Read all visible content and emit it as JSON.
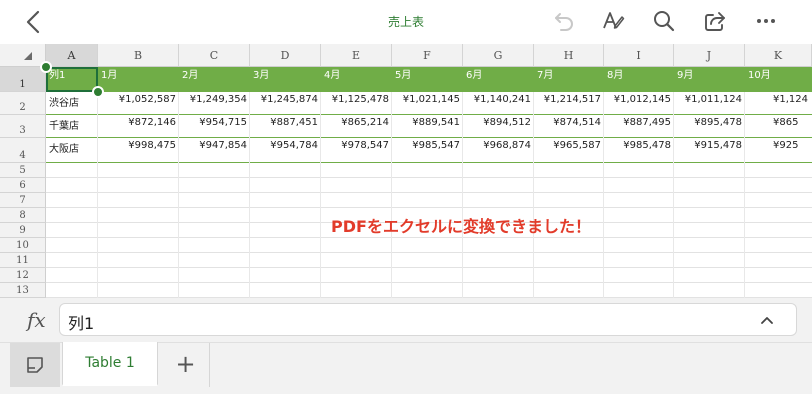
{
  "toolbar": {
    "title": "売上表"
  },
  "columns": [
    "A",
    "B",
    "C",
    "D",
    "E",
    "F",
    "G",
    "H",
    "I",
    "J",
    "K"
  ],
  "rows": [
    "1",
    "2",
    "3",
    "4",
    "5",
    "6",
    "7",
    "8",
    "9",
    "10",
    "11",
    "12",
    "13"
  ],
  "table": {
    "header": [
      "列1",
      "1月",
      "2月",
      "3月",
      "4月",
      "5月",
      "6月",
      "7月",
      "8月",
      "9月",
      "10月"
    ],
    "data": [
      [
        "渋谷店",
        "¥1,052,587",
        "¥1,249,354",
        "¥1,245,874",
        "¥1,125,478",
        "¥1,021,145",
        "¥1,140,241",
        "¥1,214,517",
        "¥1,012,145",
        "¥1,011,124",
        "¥1,124"
      ],
      [
        "千葉店",
        "¥872,146",
        "¥954,715",
        "¥887,451",
        "¥865,214",
        "¥889,541",
        "¥894,512",
        "¥874,514",
        "¥887,495",
        "¥895,478",
        "¥865"
      ],
      [
        "大阪店",
        "¥998,475",
        "¥947,854",
        "¥954,784",
        "¥978,547",
        "¥985,547",
        "¥968,874",
        "¥965,587",
        "¥985,478",
        "¥915,478",
        "¥925"
      ]
    ]
  },
  "overlay_text": "PDFをエクセルに変換できました！",
  "formula_bar": {
    "fx_label": "fx",
    "value": "列1"
  },
  "sheet_tabs": {
    "active_tab": "Table 1",
    "add_label": "+"
  },
  "colors": {
    "header_fill": "#70ad47",
    "accent": "#2e7d32",
    "overlay_text": "#e23b2a"
  },
  "icons": [
    "back-chevron-icon",
    "undo-icon",
    "annotate-icon",
    "search-icon",
    "share-icon",
    "more-icon",
    "select-all-icon",
    "fx-icon",
    "chevron-up-icon",
    "sheet-view-icon",
    "add-icon"
  ]
}
